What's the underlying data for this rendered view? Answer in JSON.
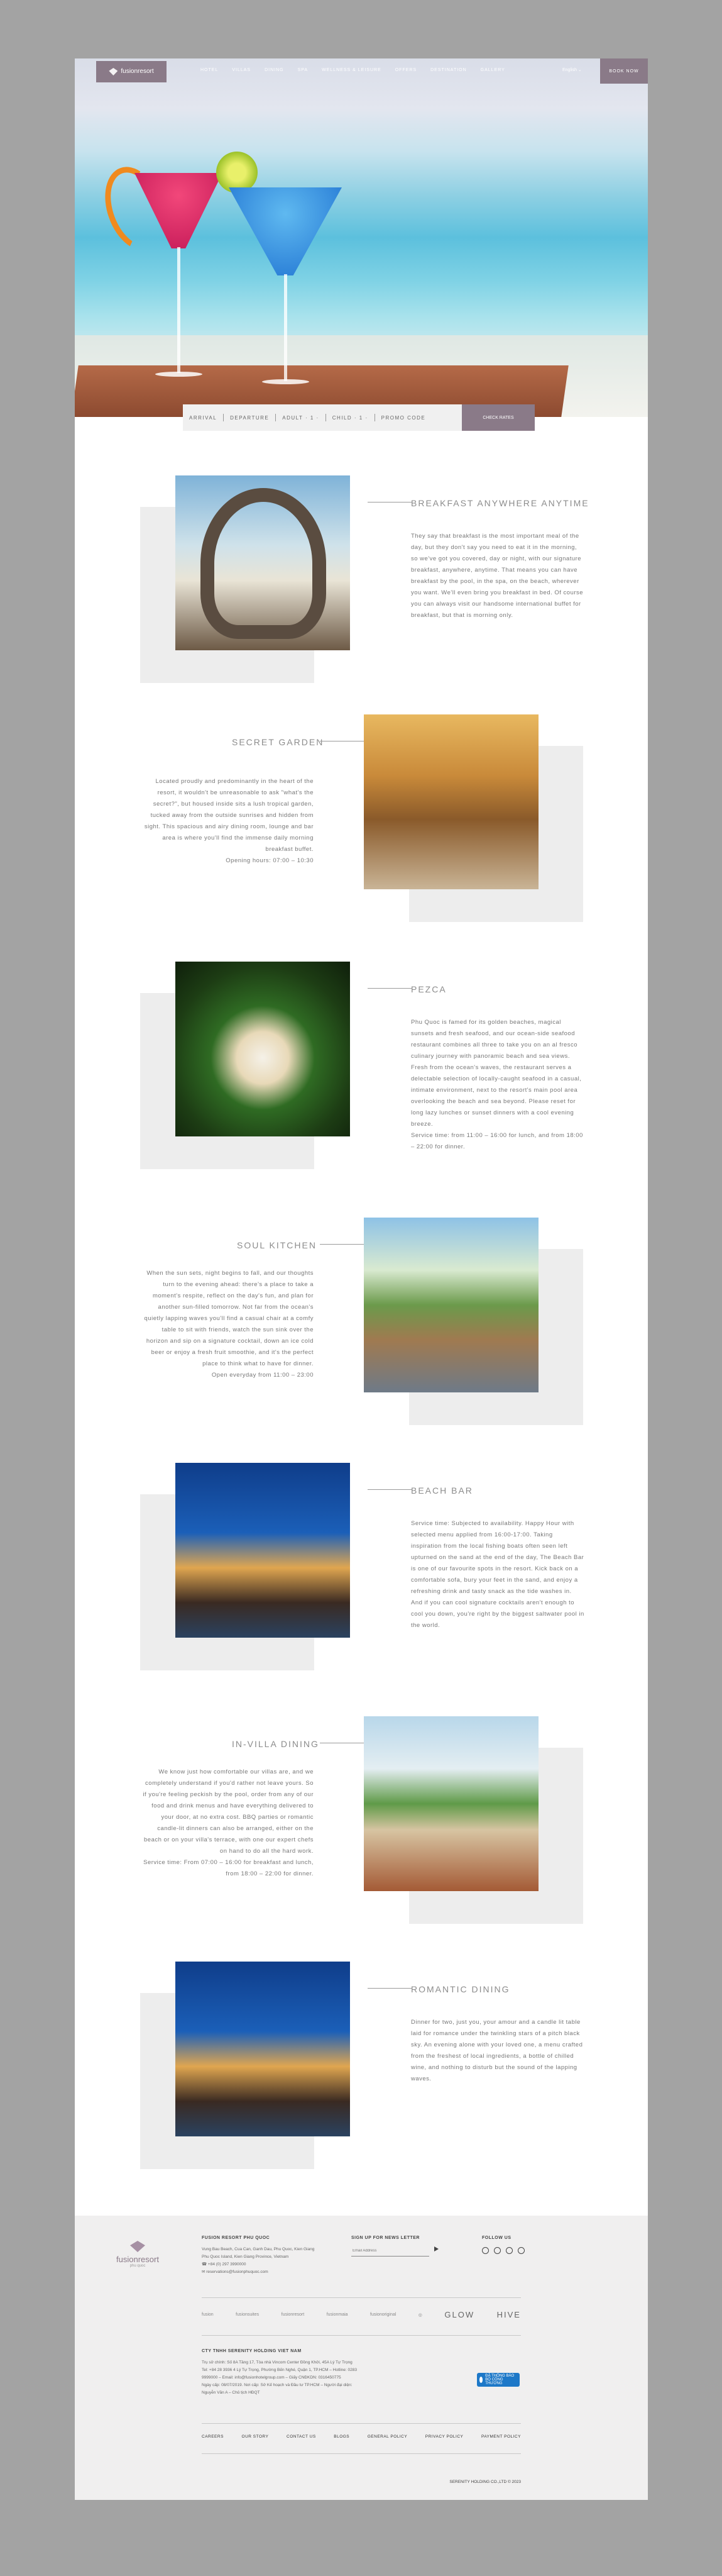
{
  "header": {
    "logo_name": "fusionresort",
    "logo_sub": "phu quoc",
    "menu": [
      "HOTEL",
      "VILLAS",
      "DINING",
      "SPA",
      "WELLNESS & LEISURE",
      "OFFERS",
      "DESTINATION",
      "GALLERY"
    ],
    "language": "English ⌄",
    "book_now": "BOOK NOW"
  },
  "booking_bar": {
    "arrival": "ARRIVAL",
    "departure": "DEPARTURE",
    "adult": "ADULT · 1 ·",
    "child": "CHILD · 1 ·",
    "promo": "PROMO CODE",
    "check": "CHECK RATES"
  },
  "sections": [
    {
      "title": "BREAKFAST ANYWHERE ANYTIME",
      "text": "They say that breakfast is the most important meal of the day, but they don't say you need to eat it in the morning, so we've got you covered, day or night, with our signature breakfast, anywhere, anytime. That means you can have breakfast by the pool, in the spa, on the beach, wherever you want. We'll even bring you breakfast in bed. Of course you can always visit our handsome international buffet for breakfast, but that is morning only."
    },
    {
      "title": "SECRET GARDEN",
      "text": "Located proudly and predominantly in the heart of the resort, it wouldn't be unreasonable to ask \"what's the secret?\", but housed inside sits a lush tropical garden, tucked away from the outside sunrises and hidden from sight. This spacious and airy dining room, lounge and bar area is where you'll find the immense daily morning breakfast buffet.",
      "hours": "Opening hours: 07:00 – 10:30"
    },
    {
      "title": "PEZCA",
      "text": "Phu Quoc is famed for its golden beaches, magical sunsets and fresh seafood, and our ocean-side seafood restaurant combines all three to take you on an al fresco culinary journey with panoramic beach and sea views. Fresh from the ocean's waves, the restaurant serves a delectable selection of locally-caught seafood in a casual, intimate environment, next to the resort's main pool area overlooking the beach and sea beyond. Please reset for long lazy lunches or sunset dinners with a cool evening breeze.",
      "hours": "Service time: from 11:00 – 16:00 for lunch, and from 18:00 – 22:00 for dinner."
    },
    {
      "title": "SOUL KITCHEN",
      "text": "When the sun sets, night begins to fall, and our thoughts turn to the evening ahead: there's a place to take a moment's respite, reflect on the day's fun, and plan for another sun-filled tomorrow. Not far from the ocean's quietly lapping waves you'll find a casual chair at a comfy table to sit with friends, watch the sun sink over the horizon and sip on a signature cocktail, down an ice cold beer or enjoy a fresh fruit smoothie, and it's the perfect place to think what to have for dinner.",
      "hours": "Open everyday from 11:00 – 23:00"
    },
    {
      "title": "BEACH BAR",
      "text": "Service time: Subjected to availability. Happy Hour with selected menu applied from 16:00-17:00. Taking inspiration from the local fishing boats often seen left upturned on the sand at the end of the day, The Beach Bar is one of our favourite spots in the resort. Kick back on a comfortable sofa, bury your feet in the sand, and enjoy a refreshing drink and tasty snack as the tide washes in. And if you can cool signature cocktails aren't enough to cool you down, you're right by the biggest saltwater pool in the world."
    },
    {
      "title": "IN-VILLA DINING",
      "text": "We know just how comfortable our villas are, and we completely understand if you'd rather not leave yours. So if you're feeling peckish by the pool, order from any of our food and drink menus and have everything delivered to your door, at no extra cost. BBQ parties or romantic candle-lit dinners can also be arranged, either on the beach or on your villa's terrace, with one our expert chefs on hand to do all the hard work.",
      "hours": "Service time: From 07:00 – 16:00 for breakfast and lunch, from 18:00 – 22:00 for dinner."
    },
    {
      "title": "ROMANTIC DINING",
      "text": "Dinner for two, just you, your amour and a candle lit table laid for romance under the twinkling stars of a pitch black sky. An evening alone with your loved one, a menu crafted from the freshest of local ingredients, a bottle of chilled wine, and nothing to disturb but the sound of the lapping waves."
    }
  ],
  "footer": {
    "logo_name": "fusionresort",
    "logo_sub": "phu quoc",
    "resort_title": "FUSION RESORT PHU QUOC",
    "address": "Vung Bau Beach, Cua Can, Ganh Dau, Phu Quoc, Kien Giang",
    "address2": "Phu Quoc Island, Kien Giang Province, Vietnam",
    "phone": "+84 (0) 297 3990000",
    "email": "reservations@fusionphuquoc.com",
    "newsletter_title": "SIGN UP FOR NEWS LETTER",
    "newsletter_placeholder": "Email Address",
    "follow_title": "FOLLOW US",
    "brands": [
      "fusion",
      "fusionsuites",
      "fusionresort",
      "fusionmaia",
      "fusionoriginal",
      "",
      "GLOW",
      "HIVE"
    ],
    "company_title": "CTY TNHH SERENITY HOLDING VIET NAM",
    "company_lines": [
      "Trụ sở chính: Số 8A Tầng 17, Tòa nhà Vincom Center Đồng Khởi, 45A Lý Tự Trọng",
      "Tel: +84 28 3936 4 Lý Tự Trọng, Phường Bến Nghé, Quận 1, TP.HCM – Hotline: 0283",
      "9999000 – Email: info@fusionhotelgroup.com – Giấy CNĐKDN: 0316450775",
      "Ngày cấp: 08/07/2019. Nơi cấp: Sở Kế hoạch và Đầu tư TP.HCM – Người đại diện:",
      "Nguyễn Văn A – Chủ tịch HĐQT"
    ],
    "links": [
      "CAREERS",
      "OUR STORY",
      "CONTACT US",
      "BLOGS",
      "GENERAL POLICY",
      "PRIVACY POLICY",
      "PAYMENT POLICY"
    ],
    "badge_text": "ĐÃ THÔNG BÁO BỘ CÔNG THƯƠNG",
    "copyright": "SERENITY HOLDING CO.,LTD © 2023"
  }
}
